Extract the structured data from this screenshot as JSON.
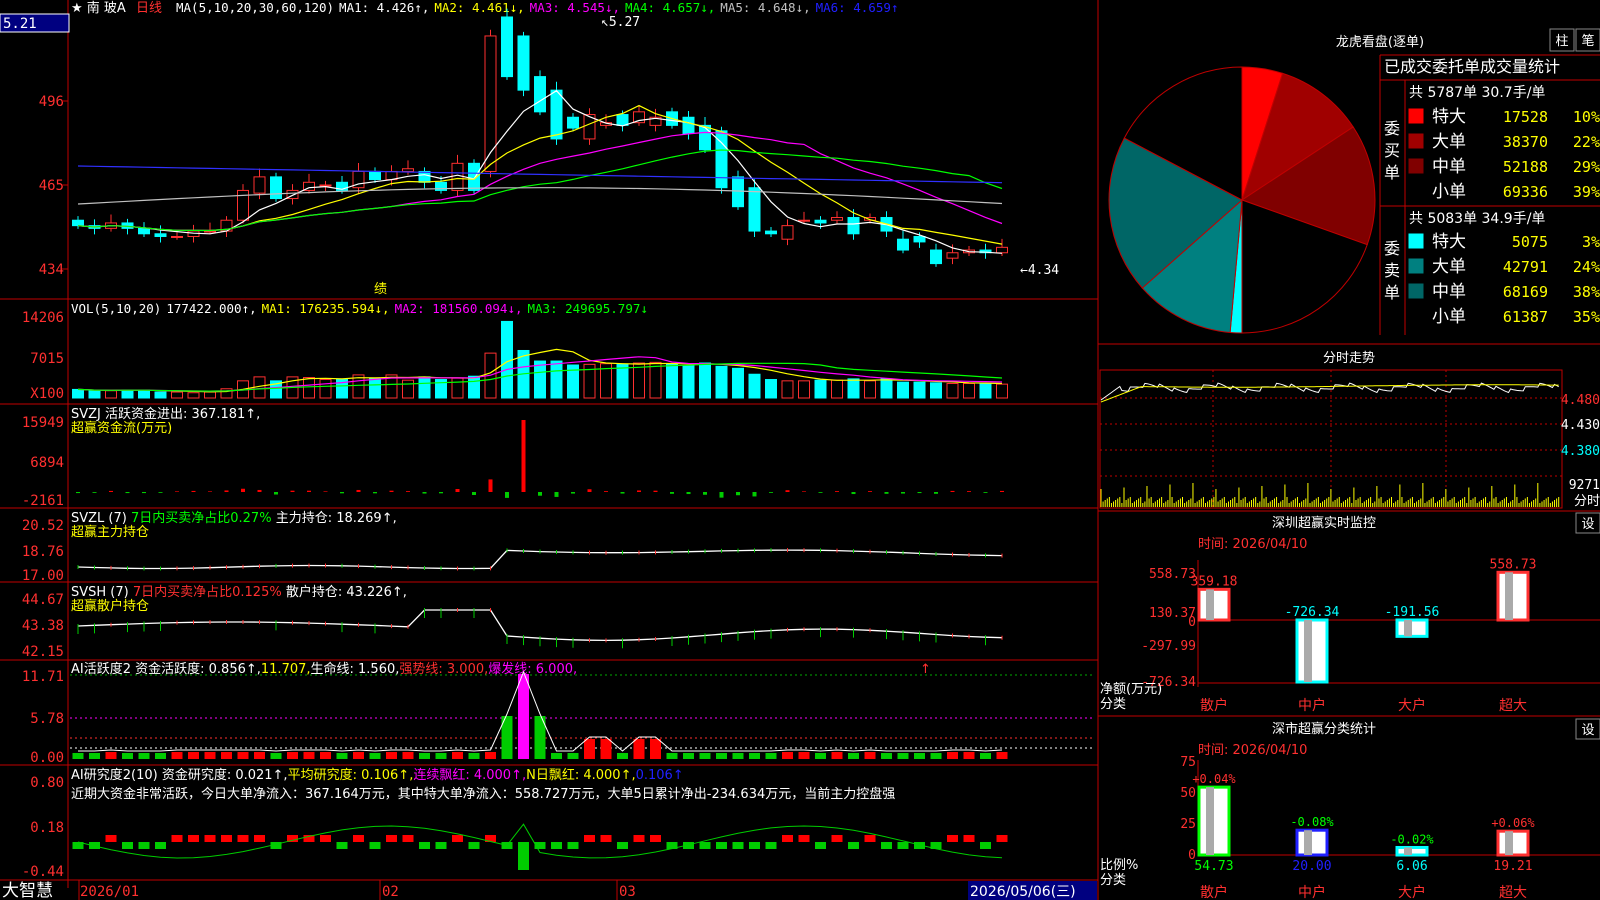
{
  "header": {
    "star": "★",
    "name": "南  玻A",
    "period": "日线",
    "price_box": "5.21"
  },
  "brand": "大智慧",
  "xaxis": {
    "left": "2026/01",
    "m2": "02",
    "m3": "03",
    "current": "2026/05/06(三)"
  },
  "ma_line": [
    {
      "text": "MA(5,10,20,30,60,120)",
      "color": "#ffffff"
    },
    {
      "text": "MA1: 4.426↑,",
      "color": "#ffffff"
    },
    {
      "text": "MA2: 4.461↓,",
      "color": "#ffff00"
    },
    {
      "text": "MA3: 4.545↓,",
      "color": "#ff00ff"
    },
    {
      "text": "MA4: 4.657↓,",
      "color": "#00ff00"
    },
    {
      "text": "MA5: 4.648↓,",
      "color": "#c0c0c0"
    },
    {
      "text": "MA6: 4.659↑",
      "color": "#2020ff"
    }
  ],
  "price_labels": {
    "ticks": [
      "496",
      "465",
      "434"
    ],
    "high": "5.27",
    "low": "4.34",
    "note": "绩"
  },
  "vol_line": [
    {
      "text": "VOL(5,10,20)",
      "color": "#ffffff"
    },
    {
      "text": "177422.000↑,",
      "color": "#ffffff"
    },
    {
      "text": "MA1: 176235.594↓,",
      "color": "#ffff00"
    },
    {
      "text": "MA2: 181560.094↓,",
      "color": "#ff00ff"
    },
    {
      "text": "MA3: 249695.797↓",
      "color": "#00ff00"
    }
  ],
  "vol_ticks": [
    "14206",
    "7015",
    "X100"
  ],
  "svzj": {
    "line1": "SVZJ  活跃资金进出: 367.181↑,",
    "line2": "超赢资金流(万元)",
    "ticks": [
      "15949",
      "6894",
      "-2161"
    ]
  },
  "svzl": {
    "p1": "SVZL (7) ",
    "p2": "7日内买卖净占比0.27%",
    "p3": " 主力持仓: 18.269↑,",
    "line2": "超赢主力持仓",
    "ticks": [
      "20.52",
      "18.76",
      "17.00"
    ]
  },
  "svsh": {
    "p1": "SVSH (7) ",
    "p2": "7日内买卖净占比0.125%",
    "p3": " 散户持仓: 43.226↑,",
    "line2": "超赢散户持仓",
    "ticks": [
      "44.67",
      "43.38",
      "42.15"
    ]
  },
  "ai1": {
    "p1": "AI活跃度2 资金活跃度: 0.856↑,",
    "p2": "11.707,",
    "p3": "生命线: 1.560,",
    "p4": "强势线: 3.000,",
    "p5": "爆发线: 6.000,",
    "ticks": [
      "11.71",
      "5.78",
      "0.00"
    ]
  },
  "ai2": {
    "p1": "AI研究度2(10) 资金研究度: 0.021↑,",
    "p2": "平均研究度: 0.106↑,",
    "p3": "连续飘红: 4.000↑,",
    "p4": "N日飘红: 4.000↑,",
    "p5": "0.106↑",
    "line2": "近期大资金非常活跃，今日大单净流入：367.164万元，其中特大单净流入：558.727万元，大单5日累计净出-234.634万元，当前主力控盘强",
    "ticks": [
      "0.80",
      "0.18",
      "-0.44"
    ]
  },
  "dragon": {
    "title": "龙虎看盘(逐单)",
    "btn1": "柱",
    "btn2": "笔",
    "subtitle": "已成交委托单成交量统计",
    "buy_label": "委买单",
    "sell_label": "委卖单",
    "buy_total": "共 5787单 30.7手/单",
    "sell_total": "共 5083单 34.9手/单",
    "buy_rows": [
      {
        "label": "特大",
        "value": "17528",
        "pct": "10%",
        "color": "#ff0000"
      },
      {
        "label": "大单",
        "value": "38370",
        "pct": "22%",
        "color": "#a00000"
      },
      {
        "label": "中单",
        "value": "52188",
        "pct": "29%",
        "color": "#800000"
      },
      {
        "label": "小单",
        "value": "69336",
        "pct": "39%",
        "color": "#000000"
      }
    ],
    "sell_rows": [
      {
        "label": "特大",
        "value": "5075",
        "pct": "3%",
        "color": "#00ffff"
      },
      {
        "label": "大单",
        "value": "42791",
        "pct": "24%",
        "color": "#008080"
      },
      {
        "label": "中单",
        "value": "68169",
        "pct": "38%",
        "color": "#006666"
      },
      {
        "label": "小单",
        "value": "61387",
        "pct": "35%",
        "color": "#000000"
      }
    ]
  },
  "minute": {
    "title": "分时走势",
    "ticks": [
      "4.480",
      "4.430",
      "4.380"
    ],
    "vol": "9271",
    "vol_label": "分时"
  },
  "monitor": {
    "title": "深圳超赢实时监控",
    "btn": "设",
    "time": "时间: 2026/04/10",
    "ticks": [
      "558.73",
      "130.37",
      "0",
      "-297.99",
      "-726.34"
    ],
    "ylabel1": "净额(万元)",
    "ylabel2": "分类",
    "cats": [
      "散户",
      "中户",
      "大户",
      "超大"
    ],
    "values": [
      "359.18",
      "-726.34",
      "-191.56",
      "558.73"
    ]
  },
  "classify": {
    "title": "深市超赢分类统计",
    "btn": "设",
    "time": "时间: 2026/04/10",
    "ticks": [
      "75",
      "50",
      "25",
      "0"
    ],
    "ylabel1": "比例%",
    "ylabel2": "分类",
    "cats": [
      "散户",
      "中户",
      "大户",
      "超大"
    ],
    "deltas": [
      "+0.04%",
      "-0.08%",
      "-0.02%",
      "+0.06%"
    ],
    "values": [
      "54.73",
      "20.00",
      "6.06",
      "19.21"
    ]
  },
  "chart_data": {
    "type": "table",
    "candles": {
      "open": [
        4.52,
        4.5,
        4.49,
        4.51,
        4.49,
        4.47,
        4.46,
        4.46,
        4.48,
        4.48,
        4.52,
        4.62,
        4.68,
        4.6,
        4.63,
        4.65,
        4.66,
        4.64,
        4.7,
        4.67,
        4.7,
        4.7,
        4.66,
        4.63,
        4.73,
        4.7,
        5.27,
        5.2,
        5.05,
        5.0,
        4.9,
        4.82,
        4.87,
        4.91,
        4.88,
        4.87,
        4.92,
        4.9,
        4.87,
        4.85,
        4.68,
        4.64,
        4.48,
        4.45,
        4.52,
        4.52,
        4.52,
        4.53,
        4.52,
        4.53,
        4.45,
        4.46,
        4.41,
        4.38,
        4.4,
        4.41,
        4.4
      ],
      "close": [
        4.5,
        4.49,
        4.51,
        4.49,
        4.47,
        4.46,
        4.46,
        4.48,
        4.48,
        4.52,
        4.63,
        4.68,
        4.6,
        4.63,
        4.66,
        4.65,
        4.63,
        4.7,
        4.67,
        4.7,
        4.71,
        4.66,
        4.63,
        4.73,
        4.63,
        5.2,
        5.05,
        5.0,
        4.92,
        4.82,
        4.86,
        4.91,
        4.88,
        4.87,
        4.92,
        4.9,
        4.87,
        4.84,
        4.78,
        4.64,
        4.57,
        4.48,
        4.47,
        4.5,
        4.52,
        4.51,
        4.53,
        4.47,
        4.53,
        4.48,
        4.41,
        4.44,
        4.36,
        4.4,
        4.41,
        4.4,
        4.42
      ]
    },
    "volume": [
      13,
      11,
      11,
      12,
      12,
      9,
      9,
      8,
      9,
      14,
      26,
      32,
      26,
      32,
      31,
      28,
      28,
      35,
      30,
      35,
      27,
      32,
      28,
      30,
      33,
      68,
      116,
      72,
      56,
      56,
      50,
      51,
      52,
      51,
      53,
      54,
      51,
      49,
      53,
      48,
      45,
      36,
      28,
      26,
      26,
      27,
      27,
      29,
      26,
      29,
      24,
      24,
      23,
      22,
      22,
      22,
      21
    ],
    "dragon_buy": [
      17528,
      38370,
      52188,
      69336
    ],
    "dragon_sell": [
      5075,
      42791,
      68169,
      61387
    ],
    "monitor_net": [
      359.18,
      -726.34,
      -191.56,
      558.73
    ],
    "classify_pct": [
      54.73,
      20.0,
      6.06,
      19.21
    ]
  }
}
